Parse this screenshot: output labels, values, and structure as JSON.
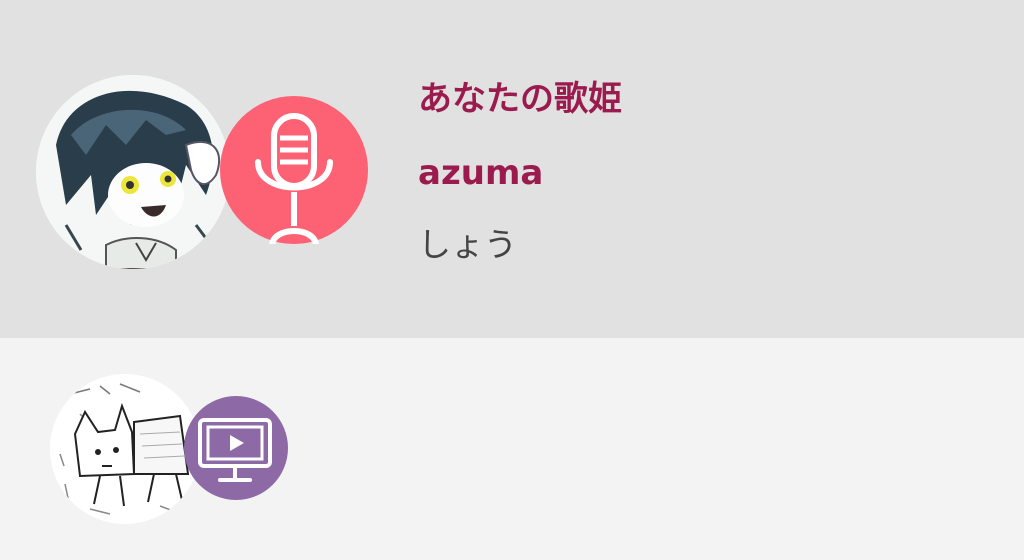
{
  "colors": {
    "accent": "#9b1b4f",
    "mic_badge": "#fd6174",
    "video_badge": "#8d6aa6",
    "sub_text": "#444444"
  },
  "items": [
    {
      "title": "あなたの歌姫",
      "artist": "azuma",
      "subtitle": "しょう",
      "avatar": "anime-girl-avatar",
      "badge_icon": "microphone-icon"
    },
    {
      "avatar": "sketch-cat-avatar",
      "badge_icon": "video-monitor-icon"
    }
  ]
}
